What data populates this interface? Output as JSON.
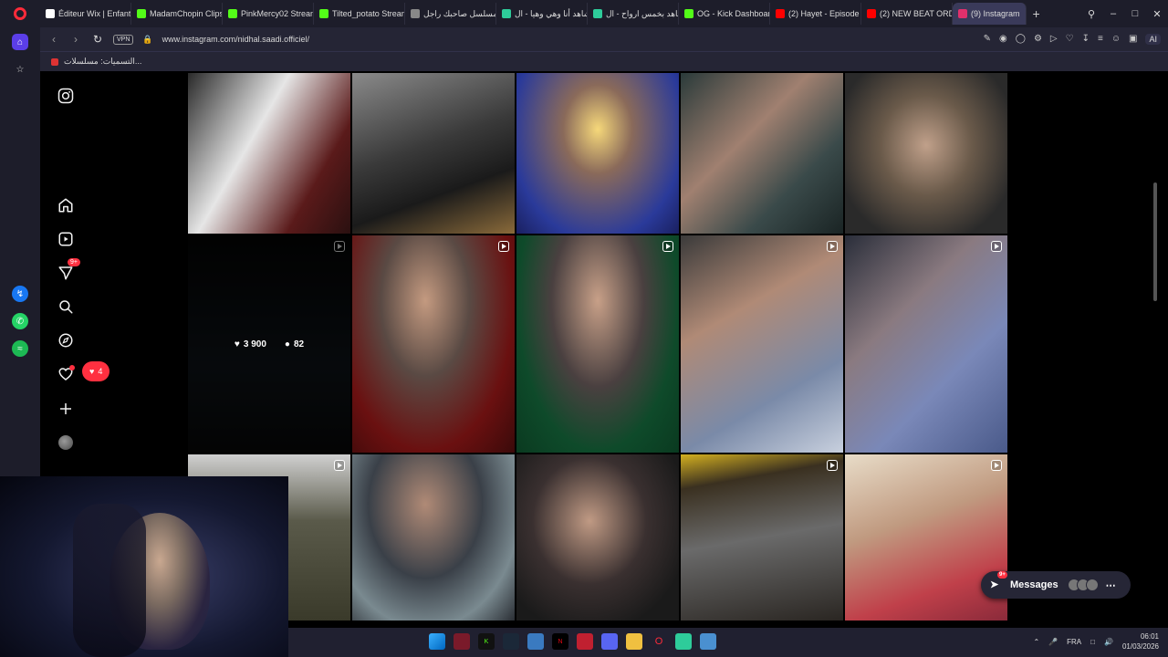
{
  "browser": {
    "tabs": [
      {
        "label": "Éditeur Wix | Enfant",
        "color": "#ffffff"
      },
      {
        "label": "MadamChopin Clips",
        "color": "#53fc18"
      },
      {
        "label": "PinkMercy02 Stream",
        "color": "#53fc18"
      },
      {
        "label": "Tilted_potato Stream",
        "color": "#53fc18"
      },
      {
        "label": "مسلسل صاحبك راجل",
        "color": "#888888"
      },
      {
        "label": "شاهد أنا وهي وهيا - ال",
        "color": "#2ecc9a"
      },
      {
        "label": "شاهد بخمس ارواح - ال",
        "color": "#2ecc9a"
      },
      {
        "label": "OG - Kick Dashboard",
        "color": "#53fc18"
      },
      {
        "label": "(2) Hayet - Episode",
        "color": "#ff0000"
      },
      {
        "label": "(2) NEW BEAT ORDE",
        "color": "#ff0000"
      },
      {
        "label": "(9) Instagram",
        "color": "#e1306c"
      }
    ],
    "url": "www.instagram.com/nidhal.saadi.officiel/",
    "vpn_label": "VPN",
    "ai_label": "AI",
    "bookmark_label": "التسميات: مسلسلات..."
  },
  "instagram": {
    "nav": {
      "logo_icon": "instagram-logo-icon",
      "messages_badge": "9+",
      "notifications_count": "4"
    },
    "hover_stats": {
      "likes": "3 900",
      "comments": "82"
    },
    "messages_pill": {
      "label": "Messages",
      "badge": "9+"
    }
  },
  "taskbar": {
    "language": "FRA",
    "time": "06:01",
    "date": "01/03/2026"
  },
  "colors": {
    "accent_red": "#ff3040",
    "browser_bg": "#1d1d2a",
    "address_bg": "#252535"
  }
}
